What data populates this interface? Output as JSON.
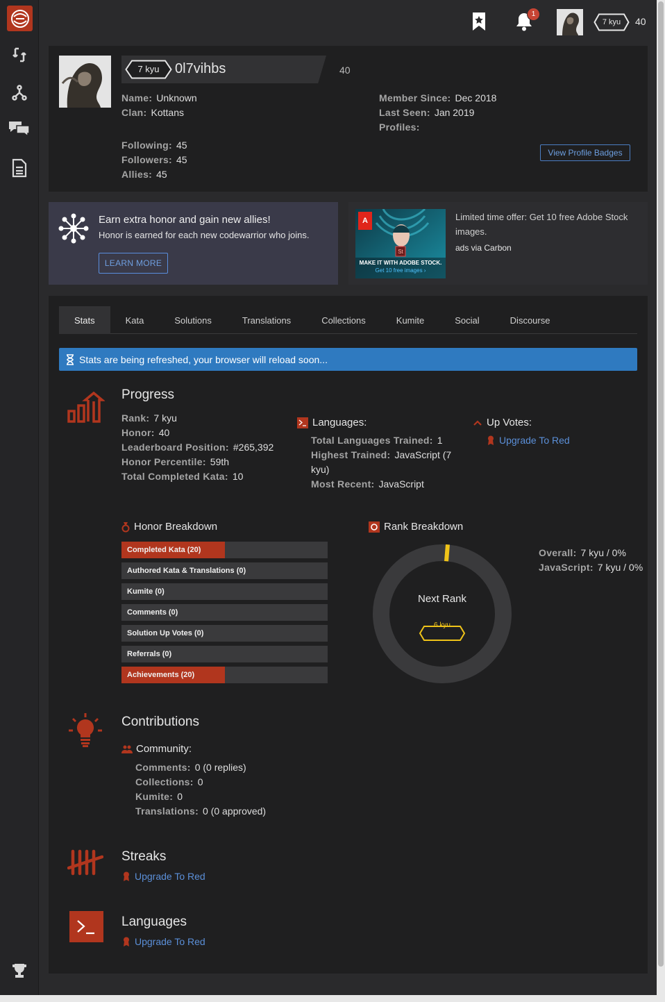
{
  "topbar": {
    "notification_count": "1",
    "rank": "7 kyu",
    "honor": "40"
  },
  "profile": {
    "rank": "7 kyu",
    "username": "0l7vihbs",
    "honor": "40",
    "name_label": "Name:",
    "name": "Unknown",
    "clan_label": "Clan:",
    "clan": "Kottans",
    "following_label": "Following:",
    "following": "45",
    "followers_label": "Followers:",
    "followers": "45",
    "allies_label": "Allies:",
    "allies": "45",
    "member_since_label": "Member Since:",
    "member_since": "Dec 2018",
    "last_seen_label": "Last Seen:",
    "last_seen": "Jan 2019",
    "profiles_label": "Profiles:",
    "badges_button": "View Profile Badges"
  },
  "promo": {
    "title": "Earn extra honor and gain new allies!",
    "subtitle": "Honor is earned for each new codewarrior who joins.",
    "button": "LEARN MORE"
  },
  "ad": {
    "image_caption": "MAKE IT WITH ADOBE STOCK.",
    "image_link": "Get 10 free images ›",
    "text": "Limited time offer: Get 10 free Adobe Stock images.",
    "via": "ads via Carbon"
  },
  "tabs": [
    {
      "label": "Stats"
    },
    {
      "label": "Kata"
    },
    {
      "label": "Solutions"
    },
    {
      "label": "Translations"
    },
    {
      "label": "Collections"
    },
    {
      "label": "Kumite"
    },
    {
      "label": "Social"
    },
    {
      "label": "Discourse"
    }
  ],
  "alert": "Stats are being refreshed, your browser will reload soon...",
  "progress": {
    "title": "Progress",
    "rank_label": "Rank:",
    "rank": "7 kyu",
    "honor_label": "Honor:",
    "honor": "40",
    "leaderboard_label": "Leaderboard Position:",
    "leaderboard": "#265,392",
    "percentile_label": "Honor Percentile:",
    "percentile": "59th",
    "completed_label": "Total Completed Kata:",
    "completed": "10"
  },
  "languages_stats": {
    "title": "Languages:",
    "trained_label": "Total Languages Trained:",
    "trained": "1",
    "highest_label": "Highest Trained:",
    "highest_a": "JavaScript (7",
    "highest_b": "kyu)",
    "recent_label": "Most Recent:",
    "recent": "JavaScript"
  },
  "upvotes": {
    "title": "Up Votes:",
    "upgrade": "Upgrade To Red"
  },
  "honor_breakdown": {
    "title": "Honor Breakdown",
    "items": [
      {
        "label": "Completed Kata (20)",
        "fill": 0.5
      },
      {
        "label": "Authored Kata & Translations (0)",
        "fill": 0
      },
      {
        "label": "Kumite (0)",
        "fill": 0
      },
      {
        "label": "Comments (0)",
        "fill": 0
      },
      {
        "label": "Solution Up Votes (0)",
        "fill": 0
      },
      {
        "label": "Referrals (0)",
        "fill": 0
      },
      {
        "label": "Achievements (20)",
        "fill": 0.5
      }
    ]
  },
  "rank_breakdown": {
    "title": "Rank Breakdown",
    "center_label": "Next Rank",
    "next_rank": "6 kyu",
    "progress_fraction": 0.0,
    "overall_label": "Overall:",
    "overall": "7 kyu / 0%",
    "javascript_label": "JavaScript:",
    "javascript": "7 kyu / 0%"
  },
  "contributions": {
    "title": "Contributions",
    "community_title": "Community:",
    "comments_label": "Comments:",
    "comments": "0 (0 replies)",
    "collections_label": "Collections:",
    "collections": "0",
    "kumite_label": "Kumite:",
    "kumite": "0",
    "translations_label": "Translations:",
    "translations": "0 (0 approved)"
  },
  "streaks": {
    "title": "Streaks",
    "upgrade": "Upgrade To Red"
  },
  "languages": {
    "title": "Languages",
    "upgrade": "Upgrade To Red"
  },
  "colors": {
    "accent": "#b1361e",
    "link": "#5b8fd8",
    "alert": "#2f7ac0",
    "rank_ring": "#f0c419"
  }
}
